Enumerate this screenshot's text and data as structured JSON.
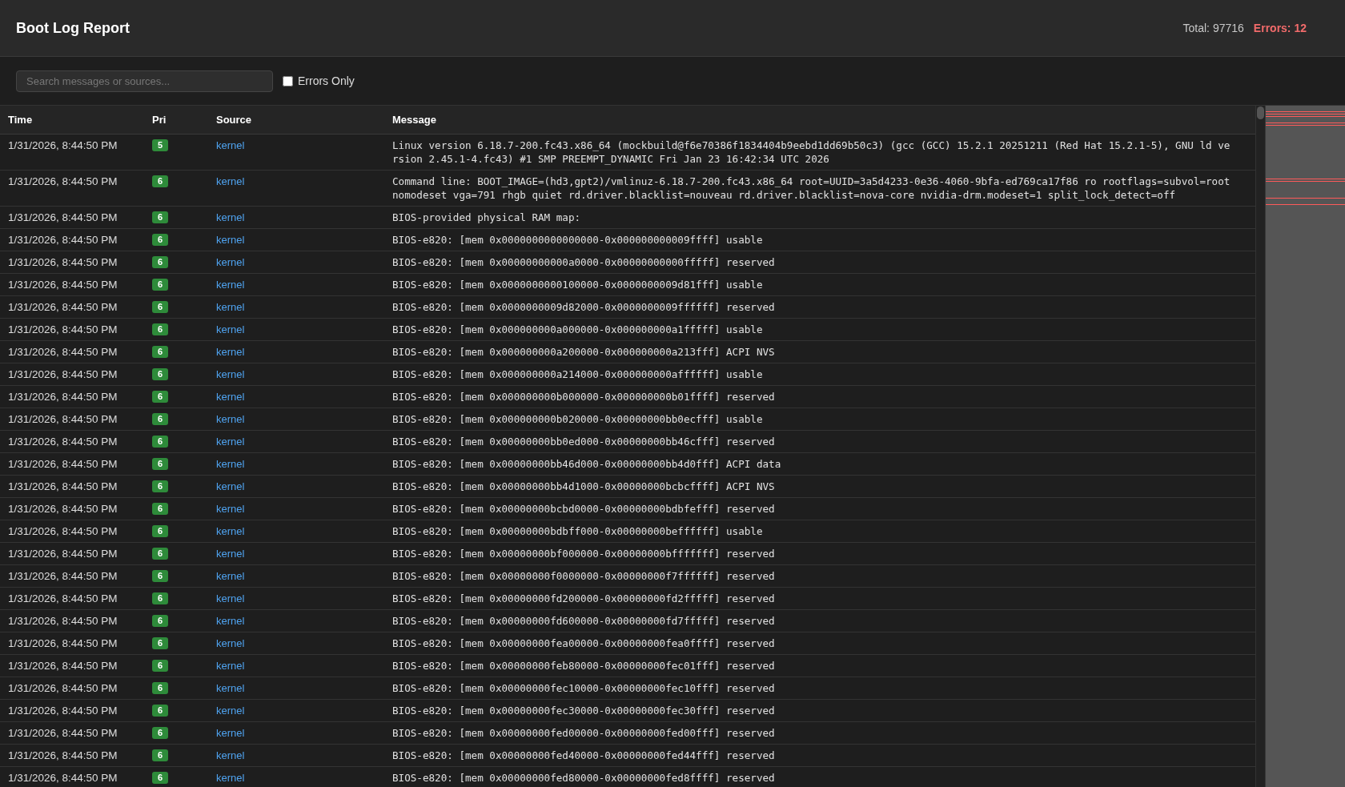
{
  "header": {
    "title": "Boot Log Report",
    "total": "Total: 97716",
    "errors": "Errors: 12"
  },
  "toolbar": {
    "search": {
      "placeholder": "Search messages or sources..."
    },
    "errors_only": {
      "label": "Errors Only",
      "checked": false
    }
  },
  "table": {
    "columns": [
      "Time",
      "Pri",
      "Source",
      "Message"
    ],
    "rows": [
      {
        "time": "1/31/2026, 8:44:50 PM",
        "priority": "5",
        "source": "kernel",
        "message": "Linux version 6.18.7-200.fc43.x86_64 (mockbuild@f6e70386f1834404b9eebd1dd69b50c3) (gcc (GCC) 15.2.1 20251211 (Red Hat 15.2.1-5), GNU ld version 2.45.1-4.fc43) #1 SMP PREEMPT_DYNAMIC Fri Jan 23 16:42:34 UTC 2026"
      },
      {
        "time": "1/31/2026, 8:44:50 PM",
        "priority": "6",
        "source": "kernel",
        "message": "Command line: BOOT_IMAGE=(hd3,gpt2)/vmlinuz-6.18.7-200.fc43.x86_64 root=UUID=3a5d4233-0e36-4060-9bfa-ed769ca17f86 ro rootflags=subvol=root nomodeset vga=791 rhgb quiet rd.driver.blacklist=nouveau rd.driver.blacklist=nova-core nvidia-drm.modeset=1 split_lock_detect=off"
      },
      {
        "time": "1/31/2026, 8:44:50 PM",
        "priority": "6",
        "source": "kernel",
        "message": "BIOS-provided physical RAM map:"
      },
      {
        "time": "1/31/2026, 8:44:50 PM",
        "priority": "6",
        "source": "kernel",
        "message": "BIOS-e820: [mem 0x0000000000000000-0x000000000009ffff] usable"
      },
      {
        "time": "1/31/2026, 8:44:50 PM",
        "priority": "6",
        "source": "kernel",
        "message": "BIOS-e820: [mem 0x00000000000a0000-0x00000000000fffff] reserved"
      },
      {
        "time": "1/31/2026, 8:44:50 PM",
        "priority": "6",
        "source": "kernel",
        "message": "BIOS-e820: [mem 0x0000000000100000-0x0000000009d81fff] usable"
      },
      {
        "time": "1/31/2026, 8:44:50 PM",
        "priority": "6",
        "source": "kernel",
        "message": "BIOS-e820: [mem 0x0000000009d82000-0x0000000009ffffff] reserved"
      },
      {
        "time": "1/31/2026, 8:44:50 PM",
        "priority": "6",
        "source": "kernel",
        "message": "BIOS-e820: [mem 0x000000000a000000-0x000000000a1fffff] usable"
      },
      {
        "time": "1/31/2026, 8:44:50 PM",
        "priority": "6",
        "source": "kernel",
        "message": "BIOS-e820: [mem 0x000000000a200000-0x000000000a213fff] ACPI NVS"
      },
      {
        "time": "1/31/2026, 8:44:50 PM",
        "priority": "6",
        "source": "kernel",
        "message": "BIOS-e820: [mem 0x000000000a214000-0x000000000affffff] usable"
      },
      {
        "time": "1/31/2026, 8:44:50 PM",
        "priority": "6",
        "source": "kernel",
        "message": "BIOS-e820: [mem 0x000000000b000000-0x000000000b01ffff] reserved"
      },
      {
        "time": "1/31/2026, 8:44:50 PM",
        "priority": "6",
        "source": "kernel",
        "message": "BIOS-e820: [mem 0x000000000b020000-0x00000000bb0ecfff] usable"
      },
      {
        "time": "1/31/2026, 8:44:50 PM",
        "priority": "6",
        "source": "kernel",
        "message": "BIOS-e820: [mem 0x00000000bb0ed000-0x00000000bb46cfff] reserved"
      },
      {
        "time": "1/31/2026, 8:44:50 PM",
        "priority": "6",
        "source": "kernel",
        "message": "BIOS-e820: [mem 0x00000000bb46d000-0x00000000bb4d0fff] ACPI data"
      },
      {
        "time": "1/31/2026, 8:44:50 PM",
        "priority": "6",
        "source": "kernel",
        "message": "BIOS-e820: [mem 0x00000000bb4d1000-0x00000000bcbcffff] ACPI NVS"
      },
      {
        "time": "1/31/2026, 8:44:50 PM",
        "priority": "6",
        "source": "kernel",
        "message": "BIOS-e820: [mem 0x00000000bcbd0000-0x00000000bdbfefff] reserved"
      },
      {
        "time": "1/31/2026, 8:44:50 PM",
        "priority": "6",
        "source": "kernel",
        "message": "BIOS-e820: [mem 0x00000000bdbff000-0x00000000beffffff] usable"
      },
      {
        "time": "1/31/2026, 8:44:50 PM",
        "priority": "6",
        "source": "kernel",
        "message": "BIOS-e820: [mem 0x00000000bf000000-0x00000000bfffffff] reserved"
      },
      {
        "time": "1/31/2026, 8:44:50 PM",
        "priority": "6",
        "source": "kernel",
        "message": "BIOS-e820: [mem 0x00000000f0000000-0x00000000f7ffffff] reserved"
      },
      {
        "time": "1/31/2026, 8:44:50 PM",
        "priority": "6",
        "source": "kernel",
        "message": "BIOS-e820: [mem 0x00000000fd200000-0x00000000fd2fffff] reserved"
      },
      {
        "time": "1/31/2026, 8:44:50 PM",
        "priority": "6",
        "source": "kernel",
        "message": "BIOS-e820: [mem 0x00000000fd600000-0x00000000fd7fffff] reserved"
      },
      {
        "time": "1/31/2026, 8:44:50 PM",
        "priority": "6",
        "source": "kernel",
        "message": "BIOS-e820: [mem 0x00000000fea00000-0x00000000fea0ffff] reserved"
      },
      {
        "time": "1/31/2026, 8:44:50 PM",
        "priority": "6",
        "source": "kernel",
        "message": "BIOS-e820: [mem 0x00000000feb80000-0x00000000fec01fff] reserved"
      },
      {
        "time": "1/31/2026, 8:44:50 PM",
        "priority": "6",
        "source": "kernel",
        "message": "BIOS-e820: [mem 0x00000000fec10000-0x00000000fec10fff] reserved"
      },
      {
        "time": "1/31/2026, 8:44:50 PM",
        "priority": "6",
        "source": "kernel",
        "message": "BIOS-e820: [mem 0x00000000fec30000-0x00000000fec30fff] reserved"
      },
      {
        "time": "1/31/2026, 8:44:50 PM",
        "priority": "6",
        "source": "kernel",
        "message": "BIOS-e820: [mem 0x00000000fed00000-0x00000000fed00fff] reserved"
      },
      {
        "time": "1/31/2026, 8:44:50 PM",
        "priority": "6",
        "source": "kernel",
        "message": "BIOS-e820: [mem 0x00000000fed40000-0x00000000fed44fff] reserved"
      },
      {
        "time": "1/31/2026, 8:44:50 PM",
        "priority": "6",
        "source": "kernel",
        "message": "BIOS-e820: [mem 0x00000000fed80000-0x00000000fed8ffff] reserved"
      }
    ]
  }
}
